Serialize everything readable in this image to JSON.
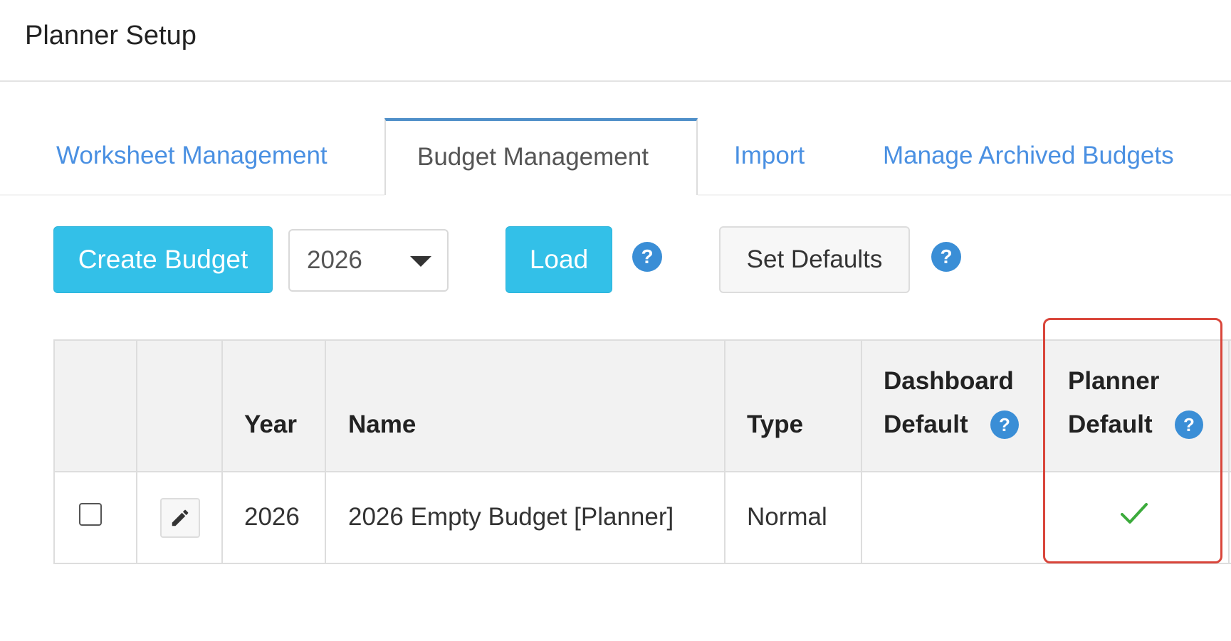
{
  "page": {
    "title": "Planner Setup"
  },
  "tabs": [
    {
      "label": "Worksheet Management",
      "active": false
    },
    {
      "label": "Budget Management",
      "active": true
    },
    {
      "label": "Import",
      "active": false
    },
    {
      "label": "Manage Archived Budgets",
      "active": false
    }
  ],
  "toolbar": {
    "create_label": "Create Budget",
    "year_select_value": "2026",
    "load_label": "Load",
    "set_defaults_label": "Set Defaults",
    "help_glyph": "?"
  },
  "table": {
    "headers": {
      "year": "Year",
      "name": "Name",
      "type": "Type",
      "dashboard_default": [
        "Dashboard",
        "Default"
      ],
      "planner_default": [
        "Planner",
        "Default"
      ]
    },
    "rows": [
      {
        "year": "2026",
        "name": "2026 Empty Budget [Planner]",
        "type": "Normal",
        "dashboard_default": false,
        "planner_default": true
      }
    ]
  },
  "colors": {
    "accent_button": "#33c0e8",
    "tab_link": "#4a90e2",
    "help_icon": "#3a8ed6",
    "check": "#3cab3c",
    "highlight": "#d9463b"
  }
}
